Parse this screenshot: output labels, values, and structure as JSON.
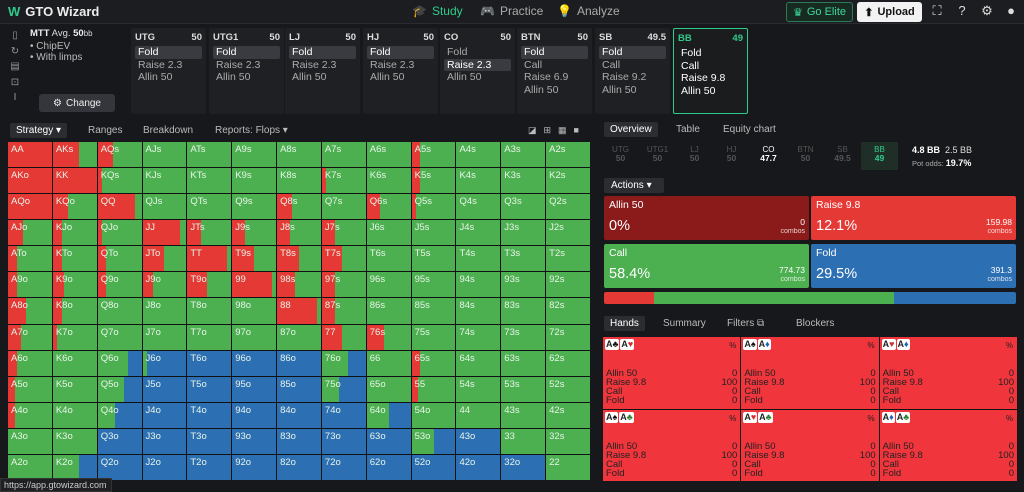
{
  "app": {
    "title": "GTO Wizard"
  },
  "nav": {
    "study": "Study",
    "practice": "Practice",
    "analyze": "Analyze"
  },
  "header": {
    "go_elite": "Go Elite",
    "upload": "Upload"
  },
  "settings": {
    "game": "MTT",
    "avg_label": "Avg.",
    "stack": "50",
    "stack_unit": "bb",
    "options": [
      "ChipEV",
      "With limps"
    ],
    "change": "Change"
  },
  "positions": [
    {
      "name": "UTG",
      "stack": "50",
      "actions": [
        "Fold",
        "Raise 2.3",
        "Allin 50"
      ],
      "selected": 0
    },
    {
      "name": "UTG1",
      "stack": "50",
      "actions": [
        "Fold",
        "Raise 2.3",
        "Allin 50"
      ],
      "selected": 0
    },
    {
      "name": "LJ",
      "stack": "50",
      "actions": [
        "Fold",
        "Raise 2.3",
        "Allin 50"
      ],
      "selected": 0
    },
    {
      "name": "HJ",
      "stack": "50",
      "actions": [
        "Fold",
        "Raise 2.3",
        "Allin 50"
      ],
      "selected": 0
    },
    {
      "name": "CO",
      "stack": "50",
      "actions": [
        "Fold",
        "Raise 2.3",
        "Allin 50"
      ],
      "selected": 1
    },
    {
      "name": "BTN",
      "stack": "50",
      "actions": [
        "Fold",
        "Call",
        "Raise 6.9",
        "Allin 50"
      ],
      "selected": 0
    },
    {
      "name": "SB",
      "stack": "49.5",
      "actions": [
        "Fold",
        "Call",
        "Raise 9.2",
        "Allin 50"
      ],
      "selected": 0
    },
    {
      "name": "BB",
      "stack": "49",
      "actions": [
        "Fold",
        "Call",
        "Raise 9.8",
        "Allin 50"
      ],
      "selected": -1
    }
  ],
  "strategy_tabs": {
    "strategy": "Strategy",
    "ranges": "Ranges",
    "breakdown": "Breakdown",
    "reports": "Reports: Flops"
  },
  "grid_colors": {
    "call": "#4caf50",
    "raise": "#e53935",
    "fold": "#2d6fb3",
    "allin": "#8b1a1a"
  },
  "hands": [
    [
      [
        "AA",
        1,
        0
      ],
      [
        "AKs",
        0.6,
        0
      ],
      [
        "AQs",
        0.35,
        0
      ],
      [
        "AJs",
        0,
        0
      ],
      [
        "ATs",
        0,
        0
      ],
      [
        "A9s",
        0,
        0
      ],
      [
        "A8s",
        0,
        0
      ],
      [
        "A7s",
        0,
        0
      ],
      [
        "A6s",
        0,
        0
      ],
      [
        "A5s",
        0.2,
        0
      ],
      [
        "A4s",
        0,
        0
      ],
      [
        "A3s",
        0,
        0
      ],
      [
        "A2s",
        0,
        0
      ]
    ],
    [
      [
        "AKo",
        1,
        0
      ],
      [
        "KK",
        1,
        0
      ],
      [
        "KQs",
        0.1,
        0
      ],
      [
        "KJs",
        0,
        0
      ],
      [
        "KTs",
        0,
        0
      ],
      [
        "K9s",
        0,
        0
      ],
      [
        "K8s",
        0,
        0
      ],
      [
        "K7s",
        0.1,
        0
      ],
      [
        "K6s",
        0,
        0
      ],
      [
        "K5s",
        0.2,
        0
      ],
      [
        "K4s",
        0,
        0
      ],
      [
        "K3s",
        0,
        0
      ],
      [
        "K2s",
        0,
        0
      ]
    ],
    [
      [
        "AQo",
        1,
        0
      ],
      [
        "KQo",
        0.35,
        0
      ],
      [
        "QQ",
        0.85,
        0
      ],
      [
        "QJs",
        0,
        0
      ],
      [
        "QTs",
        0,
        0
      ],
      [
        "Q9s",
        0,
        0
      ],
      [
        "Q8s",
        0.35,
        0
      ],
      [
        "Q7s",
        0,
        0
      ],
      [
        "Q6s",
        0.3,
        0
      ],
      [
        "Q5s",
        0.1,
        0
      ],
      [
        "Q4s",
        0,
        0
      ],
      [
        "Q3s",
        0,
        0
      ],
      [
        "Q2s",
        0,
        0
      ]
    ],
    [
      [
        "AJo",
        0.35,
        0
      ],
      [
        "KJo",
        0.2,
        0
      ],
      [
        "QJo",
        0.1,
        0
      ],
      [
        "JJ",
        0.85,
        0
      ],
      [
        "JTs",
        0.3,
        0
      ],
      [
        "J9s",
        0.3,
        0
      ],
      [
        "J8s",
        0.3,
        0
      ],
      [
        "J7s",
        0.3,
        0
      ],
      [
        "J6s",
        0,
        0
      ],
      [
        "J5s",
        0,
        0
      ],
      [
        "J4s",
        0,
        0
      ],
      [
        "J3s",
        0,
        0
      ],
      [
        "J2s",
        0,
        0
      ]
    ],
    [
      [
        "ATo",
        0.2,
        0
      ],
      [
        "KTo",
        0.2,
        0
      ],
      [
        "QTo",
        0.2,
        0
      ],
      [
        "JTo",
        0.5,
        0
      ],
      [
        "TT",
        0.9,
        0
      ],
      [
        "T9s",
        0.5,
        0
      ],
      [
        "T8s",
        0.5,
        0
      ],
      [
        "T7s",
        0.45,
        0
      ],
      [
        "T6s",
        0,
        0
      ],
      [
        "T5s",
        0,
        0
      ],
      [
        "T4s",
        0,
        0
      ],
      [
        "T3s",
        0,
        0
      ],
      [
        "T2s",
        0,
        0
      ]
    ],
    [
      [
        "A9o",
        0.2,
        0
      ],
      [
        "K9o",
        0.25,
        0
      ],
      [
        "Q9o",
        0.2,
        0
      ],
      [
        "J9o",
        0.25,
        0
      ],
      [
        "T9o",
        0.45,
        0
      ],
      [
        "99",
        0.9,
        0
      ],
      [
        "98s",
        0.4,
        0
      ],
      [
        "97s",
        0.3,
        0
      ],
      [
        "96s",
        0,
        0
      ],
      [
        "95s",
        0,
        0
      ],
      [
        "94s",
        0,
        0
      ],
      [
        "93s",
        0,
        0
      ],
      [
        "92s",
        0,
        0
      ]
    ],
    [
      [
        "A8o",
        0.4,
        0
      ],
      [
        "K8o",
        0.2,
        0
      ],
      [
        "Q8o",
        0,
        0
      ],
      [
        "J8o",
        0,
        0
      ],
      [
        "T8o",
        0,
        0
      ],
      [
        "98o",
        0,
        0
      ],
      [
        "88",
        0.9,
        0
      ],
      [
        "87s",
        0.3,
        0
      ],
      [
        "86s",
        0,
        0
      ],
      [
        "85s",
        0,
        0
      ],
      [
        "84s",
        0,
        0
      ],
      [
        "83s",
        0,
        0
      ],
      [
        "82s",
        0,
        0
      ]
    ],
    [
      [
        "A7o",
        0.3,
        0
      ],
      [
        "K7o",
        0.1,
        0
      ],
      [
        "Q7o",
        0,
        0
      ],
      [
        "J7o",
        0,
        0
      ],
      [
        "T7o",
        0,
        0
      ],
      [
        "97o",
        0,
        0
      ],
      [
        "87o",
        0,
        0
      ],
      [
        "77",
        0.45,
        0
      ],
      [
        "76s",
        0.4,
        0
      ],
      [
        "75s",
        0,
        0
      ],
      [
        "74s",
        0,
        0
      ],
      [
        "73s",
        0,
        0
      ],
      [
        "72s",
        0,
        0
      ]
    ],
    [
      [
        "A6o",
        0.2,
        0
      ],
      [
        "K6o",
        0,
        0
      ],
      [
        "Q6o",
        0,
        0.3
      ],
      [
        "J6o",
        0,
        0.9
      ],
      [
        "T6o",
        0,
        1
      ],
      [
        "96o",
        0,
        1
      ],
      [
        "86o",
        0,
        1
      ],
      [
        "76o",
        0,
        0.4
      ],
      [
        "66",
        0,
        0
      ],
      [
        "65s",
        0.2,
        0
      ],
      [
        "64s",
        0,
        0
      ],
      [
        "63s",
        0,
        0
      ],
      [
        "62s",
        0,
        0
      ]
    ],
    [
      [
        "A5o",
        0.15,
        0
      ],
      [
        "K5o",
        0,
        0
      ],
      [
        "Q5o",
        0,
        0.4
      ],
      [
        "J5o",
        0,
        1
      ],
      [
        "T5o",
        0,
        1
      ],
      [
        "95o",
        0,
        1
      ],
      [
        "85o",
        0,
        1
      ],
      [
        "75o",
        0,
        0.6
      ],
      [
        "65o",
        0,
        0
      ],
      [
        "55",
        0.15,
        0
      ],
      [
        "54s",
        0,
        0
      ],
      [
        "53s",
        0,
        0
      ],
      [
        "52s",
        0,
        0
      ]
    ],
    [
      [
        "A4o",
        0.15,
        0
      ],
      [
        "K4o",
        0,
        0
      ],
      [
        "Q4o",
        0,
        0.6
      ],
      [
        "J4o",
        0,
        1
      ],
      [
        "T4o",
        0,
        1
      ],
      [
        "94o",
        0,
        1
      ],
      [
        "84o",
        0,
        1
      ],
      [
        "74o",
        0,
        1
      ],
      [
        "64o",
        0,
        0.5
      ],
      [
        "54o",
        0,
        0
      ],
      [
        "44",
        0,
        0
      ],
      [
        "43s",
        0,
        0
      ],
      [
        "42s",
        0,
        0
      ]
    ],
    [
      [
        "A3o",
        0,
        0
      ],
      [
        "K3o",
        0,
        0
      ],
      [
        "Q3o",
        0,
        1
      ],
      [
        "J3o",
        0,
        1
      ],
      [
        "T3o",
        0,
        1
      ],
      [
        "93o",
        0,
        1
      ],
      [
        "83o",
        0,
        1
      ],
      [
        "73o",
        0,
        1
      ],
      [
        "63o",
        0,
        1
      ],
      [
        "53o",
        0,
        0.5
      ],
      [
        "43o",
        0,
        1
      ],
      [
        "33",
        0,
        0
      ],
      [
        "32s",
        0,
        0
      ]
    ],
    [
      [
        "A2o",
        0,
        0
      ],
      [
        "K2o",
        0,
        0.4
      ],
      [
        "Q2o",
        0,
        1
      ],
      [
        "J2o",
        0,
        1
      ],
      [
        "T2o",
        0,
        1
      ],
      [
        "92o",
        0,
        1
      ],
      [
        "82o",
        0,
        1
      ],
      [
        "72o",
        0,
        1
      ],
      [
        "62o",
        0,
        1
      ],
      [
        "52o",
        0,
        1
      ],
      [
        "42o",
        0,
        1
      ],
      [
        "32o",
        0,
        1
      ],
      [
        "22",
        0,
        0
      ]
    ]
  ],
  "right_tabs": {
    "overview": "Overview",
    "table": "Table",
    "equity": "Equity chart"
  },
  "seat_row": [
    {
      "name": "UTG",
      "val": "50"
    },
    {
      "name": "UTG1",
      "val": "50"
    },
    {
      "name": "LJ",
      "val": "50"
    },
    {
      "name": "HJ",
      "val": "50"
    },
    {
      "name": "CO",
      "val": "47.7"
    },
    {
      "name": "BTN",
      "val": "50"
    },
    {
      "name": "SB",
      "val": "49.5"
    },
    {
      "name": "BB",
      "val": "49"
    }
  ],
  "pot": {
    "bb": "4.8 BB",
    "stack": "2.5 BB",
    "odds_label": "Pot odds:",
    "odds": "19.7%"
  },
  "actions_label": "Actions",
  "action_boxes": [
    {
      "name": "Allin 50",
      "pct": "0%",
      "combos": "0",
      "color": "#8b1a1a"
    },
    {
      "name": "Raise 9.8",
      "pct": "12.1%",
      "combos": "159.98",
      "color": "#e53935"
    },
    {
      "name": "Call",
      "pct": "58.4%",
      "combos": "774.73",
      "color": "#4caf50"
    },
    {
      "name": "Fold",
      "pct": "29.5%",
      "combos": "391.3",
      "color": "#2d6fb3"
    }
  ],
  "combos_label": "combos",
  "stackbar": [
    {
      "frac": 0.121,
      "color": "#e53935"
    },
    {
      "frac": 0.584,
      "color": "#4caf50"
    },
    {
      "frac": 0.295,
      "color": "#2d6fb3"
    }
  ],
  "hand_tabs": {
    "hands": "Hands",
    "summary": "Summary",
    "filters": "Filters",
    "blockers": "Blockers"
  },
  "combo_cells": [
    {
      "c1": "A",
      "s1": "♣",
      "k1": "k",
      "c2": "A",
      "s2": "♥",
      "k2": "r"
    },
    {
      "c1": "A",
      "s1": "♠",
      "k1": "k",
      "c2": "A",
      "s2": "♦",
      "k2": "b"
    },
    {
      "c1": "A",
      "s1": "♥",
      "k1": "r",
      "c2": "A",
      "s2": "♦",
      "k2": "b"
    },
    {
      "c1": "A",
      "s1": "♠",
      "k1": "k",
      "c2": "A",
      "s2": "♣",
      "k2": "g"
    },
    {
      "c1": "A",
      "s1": "♥",
      "k1": "r",
      "c2": "A",
      "s2": "♣",
      "k2": "g"
    },
    {
      "c1": "A",
      "s1": "♦",
      "k1": "b",
      "c2": "A",
      "s2": "♣",
      "k2": "g"
    }
  ],
  "combo_rows": [
    {
      "name": "Allin 50",
      "val": "0"
    },
    {
      "name": "Raise 9.8",
      "val": "100"
    },
    {
      "name": "Call",
      "val": "0"
    },
    {
      "name": "Fold",
      "val": "0"
    }
  ],
  "pct_sign": "%",
  "status_url": "https://app.gtowizard.com"
}
